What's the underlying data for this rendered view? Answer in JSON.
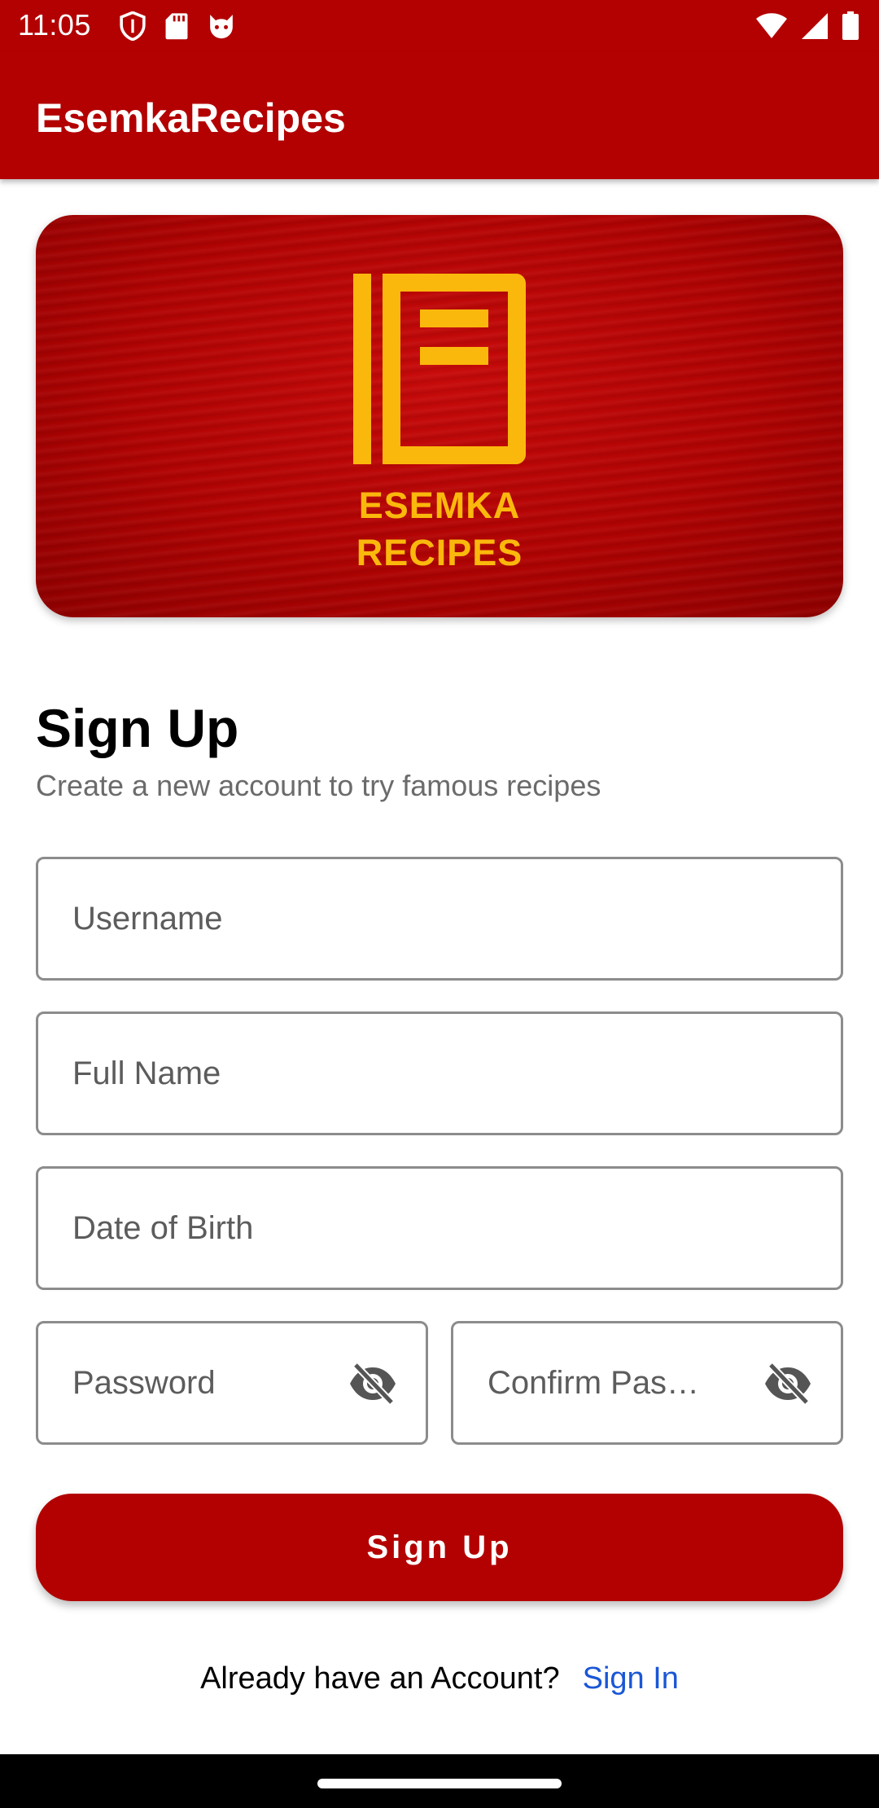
{
  "status_bar": {
    "time": "11:05",
    "left_icons": [
      "shield-icon",
      "sd-card-icon",
      "cat-face-icon"
    ],
    "right_icons": [
      "wifi-icon",
      "signal-icon",
      "battery-icon"
    ]
  },
  "app_bar": {
    "title": "EsemkaRecipes"
  },
  "banner": {
    "logo_line1": "ESEMKA",
    "logo_line2": "RECIPES",
    "logo_color": "#fbb80c",
    "background_color": "#b30000"
  },
  "form": {
    "title": "Sign Up",
    "subtitle": "Create a new account to try famous recipes",
    "username_placeholder": "Username",
    "fullname_placeholder": "Full Name",
    "dob_placeholder": "Date of Birth",
    "password_placeholder": "Password",
    "confirm_password_placeholder": "Confirm Pas…",
    "submit_label": "Sign Up"
  },
  "footer": {
    "prompt": "Already have an Account?",
    "signin_label": "Sign In",
    "link_color": "#1a56d6"
  },
  "colors": {
    "primary": "#b30000",
    "accent": "#fbb80c"
  }
}
